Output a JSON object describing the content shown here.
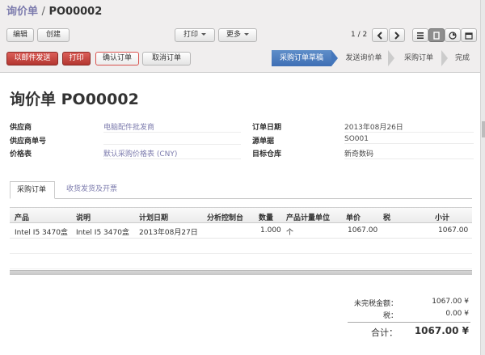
{
  "breadcrumb": {
    "parent": "询价单",
    "separator": "/",
    "current": "PO00002"
  },
  "toolbar": {
    "edit_label": "编辑",
    "create_label": "创建",
    "print_label": "打印",
    "more_label": "更多",
    "pager_text": "1 / 2"
  },
  "actions": {
    "send_email": "以邮件发送",
    "print": "打印",
    "confirm": "确认订单",
    "cancel": "取消订单"
  },
  "stages": [
    "采购订单草稿",
    "发送询价单",
    "采购订单",
    "完成"
  ],
  "active_stage_index": 0,
  "colors": {
    "accent": "#7c7bad",
    "stage_active": "#4a7bbf",
    "btn_red": "#c9423d"
  },
  "document": {
    "title": "询价单 PO00002"
  },
  "fields": {
    "supplier": {
      "label": "供应商",
      "value": "电脑配件批发商"
    },
    "supplier_ref": {
      "label": "供应商单号",
      "value": ""
    },
    "pricelist": {
      "label": "价格表",
      "value": "默认采购价格表 (CNY)"
    },
    "order_date": {
      "label": "订单日期",
      "value": "2013年08月26日"
    },
    "source": {
      "label": "源单据",
      "value": "SO001"
    },
    "warehouse": {
      "label": "目标仓库",
      "value": "新奇数码"
    }
  },
  "tabs": [
    "采购订单",
    "收货发货及开票"
  ],
  "lines": {
    "headers": [
      "产品",
      "说明",
      "计划日期",
      "分析控制台",
      "数量",
      "产品计量单位",
      "单价",
      "税",
      "小计"
    ],
    "rows": [
      {
        "product": "Intel I5 3470盒",
        "description": "Intel I5 3470盒",
        "date": "2013年08月27日",
        "analytic": "",
        "qty": "1.000",
        "uom": "个",
        "price": "1067.00",
        "tax": "",
        "subtotal": "1067.00"
      }
    ]
  },
  "summary": {
    "untaxed_label": "未完税金额：",
    "untaxed_value": "1067.00 ¥",
    "tax_label": "税：",
    "tax_value": "0.00 ¥",
    "total_label": "合计：",
    "total_value": "1067.00 ¥"
  },
  "icons": [
    "chevron-left-icon",
    "chevron-right-icon",
    "list-view-icon",
    "form-view-icon",
    "gantt-view-icon",
    "calendar-view-icon"
  ]
}
